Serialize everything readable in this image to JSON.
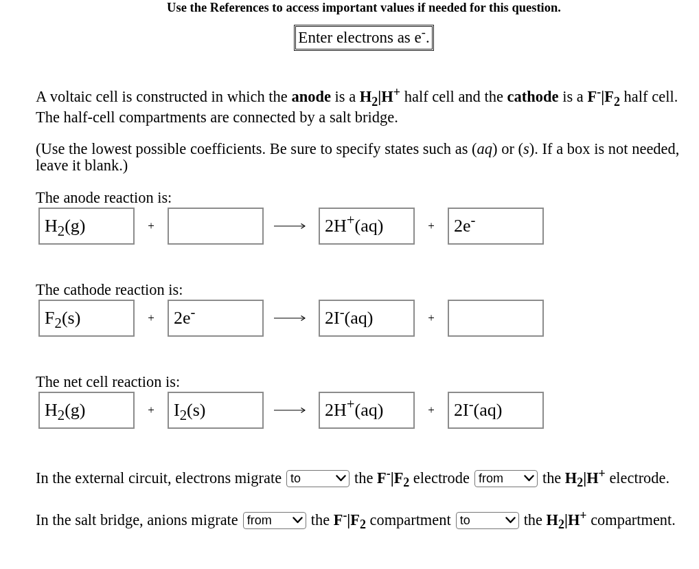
{
  "header": {
    "notice": "Use the References to access important values if needed for this question."
  },
  "hint": {
    "text": "Enter electrons as e$^{-}$."
  },
  "intro": [
    "A voltaic cell is constructed in which the **anode** is a **H$_{2}$|H$^{+}$** half cell and the **cathode** is a **F$^{-}$|F$_{2}$** half cell. The half-cell compartments are connected by a salt bridge.",
    "(Use the lowest possible coefficients. Be sure to specify states such as (*aq*) or (*s*). If a box is not needed, leave it blank.)"
  ],
  "reactions": [
    {
      "label": "The anode reaction is:",
      "terms": [
        {
          "kind": "box",
          "value": "H$_{2}$(g)"
        },
        {
          "kind": "operator",
          "text": "+"
        },
        {
          "kind": "box"
        },
        {
          "kind": "arrow"
        },
        {
          "kind": "box",
          "value": "2H$^{+}$(aq)"
        },
        {
          "kind": "operator",
          "text": "+"
        },
        {
          "kind": "box",
          "value": "2e$^{-}$"
        }
      ]
    },
    {
      "label": "The cathode reaction is:",
      "terms": [
        {
          "kind": "box",
          "value": "F$_{2}$(s)"
        },
        {
          "kind": "operator",
          "text": "+"
        },
        {
          "kind": "box",
          "value": "2e$^{-}$"
        },
        {
          "kind": "arrow"
        },
        {
          "kind": "box",
          "value": "2I$^{-}$(aq)"
        },
        {
          "kind": "operator",
          "text": "+"
        },
        {
          "kind": "box"
        }
      ]
    },
    {
      "label": "The net cell reaction is:",
      "terms": [
        {
          "kind": "box",
          "value": "H$_{2}$(g)"
        },
        {
          "kind": "operator",
          "text": "+"
        },
        {
          "kind": "box",
          "value": "I$_{2}$(s)"
        },
        {
          "kind": "arrow"
        },
        {
          "kind": "box",
          "value": "2H$^{+}$(aq)"
        },
        {
          "kind": "operator",
          "text": "+"
        },
        {
          "kind": "box",
          "value": "2I$^{-}$(aq)"
        }
      ]
    }
  ],
  "migrations": [
    {
      "parts": [
        {
          "kind": "text",
          "text": "In the external circuit, electrons migrate"
        },
        {
          "kind": "select",
          "value": "to"
        },
        {
          "kind": "text",
          "text": "the **F$^{-}$|F$_{2}$** electrode"
        },
        {
          "kind": "select",
          "value": "from"
        },
        {
          "kind": "text",
          "text": "the **H$_{2}$|H$^{+}$** electrode."
        }
      ]
    },
    {
      "parts": [
        {
          "kind": "text",
          "text": "In the salt bridge, anions migrate"
        },
        {
          "kind": "select",
          "value": "from"
        },
        {
          "kind": "text",
          "text": "the **F$^{-}$|F$_{2}$** compartment"
        },
        {
          "kind": "select",
          "value": "to"
        },
        {
          "kind": "text",
          "text": "the **H$_{2}$|H$^{+}$** compartment."
        }
      ]
    }
  ]
}
